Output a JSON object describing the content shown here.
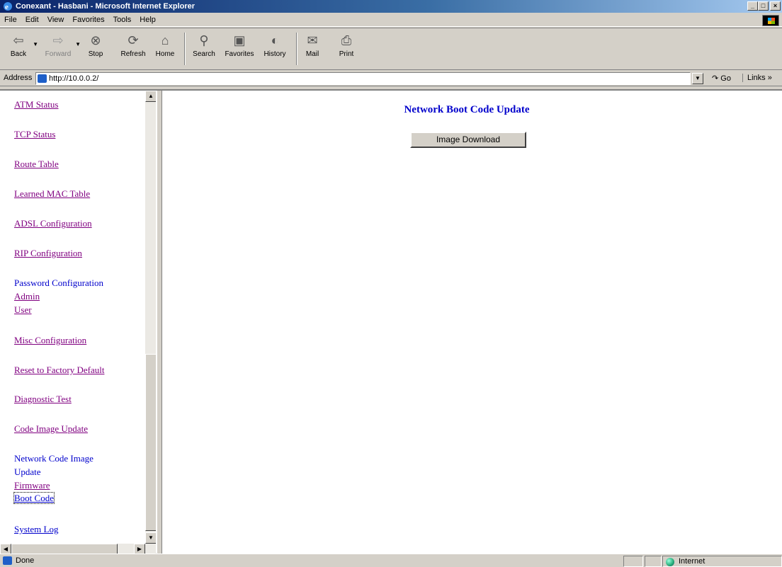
{
  "window": {
    "title": "Conexant - Hasbani - Microsoft Internet Explorer",
    "controls": [
      "_",
      "□",
      "×"
    ]
  },
  "menu": [
    "File",
    "Edit",
    "View",
    "Favorites",
    "Tools",
    "Help"
  ],
  "toolbar": {
    "buttons": [
      {
        "label": "Back",
        "icon": "back-arrow-icon"
      },
      {
        "label": "Forward",
        "icon": "forward-arrow-icon"
      },
      {
        "label": "Stop",
        "icon": "stop-icon"
      },
      {
        "label": "Refresh",
        "icon": "refresh-icon"
      },
      {
        "label": "Home",
        "icon": "home-icon"
      },
      {
        "label": "Search",
        "icon": "search-icon"
      },
      {
        "label": "Favorites",
        "icon": "favorites-icon"
      },
      {
        "label": "History",
        "icon": "history-icon"
      },
      {
        "label": "Mail",
        "icon": "mail-icon"
      },
      {
        "label": "Print",
        "icon": "print-icon"
      }
    ]
  },
  "address": {
    "label": "Address",
    "url": "http://10.0.0.2/",
    "go_label": "Go",
    "links_label": "Links"
  },
  "nav": {
    "atm_status": "ATM Status",
    "tcp_status": "TCP Status",
    "route_table": "Route Table",
    "learned_mac": "Learned MAC Table",
    "adsl_config": "ADSL Configuration",
    "rip_config": "RIP Configuration",
    "password_config": "Password Configuration",
    "admin": "Admin",
    "user": "User",
    "misc_config": "Misc Configuration",
    "reset_factory": "Reset to Factory Default",
    "diagnostic": "Diagnostic Test",
    "code_image": "Code Image Update",
    "network_code_1": "Network Code Image",
    "network_code_2": "Update",
    "firmware": "Firmware",
    "boot_code": "Boot Code",
    "system_log": "System Log"
  },
  "main": {
    "title": "Network Boot Code Update",
    "button_label": "Image Download"
  },
  "status": {
    "text": "Done",
    "zone": "Internet"
  }
}
